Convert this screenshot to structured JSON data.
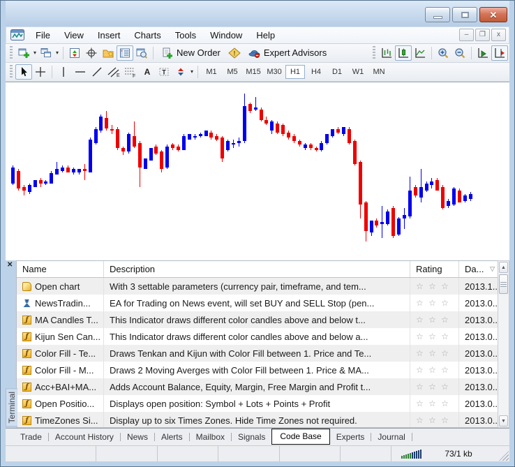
{
  "window": {
    "title": ""
  },
  "icons": {
    "app": "metatrader-logo",
    "window_minimize": "minimize-dash",
    "window_maximize": "maximize-box",
    "window_close": "✕",
    "mdi_minimize": "–",
    "mdi_restore": "❐",
    "mdi_close": "x",
    "dropdown_caret": "▾",
    "sort_desc": "▽",
    "star_empty": "☆",
    "scroll_up": "▲",
    "scroll_down": "▼",
    "panel_close": "✕",
    "channel_letter": "E",
    "fibo_letter": "F",
    "text_tool": "A",
    "text_label_tool": "T",
    "metaeditor_mark": "!"
  },
  "menu": {
    "items": [
      "File",
      "View",
      "Insert",
      "Charts",
      "Tools",
      "Window",
      "Help"
    ]
  },
  "toolbar_standard": {
    "new_order_label": "New Order",
    "expert_advisors_label": "Expert Advisors"
  },
  "toolbar_charts": {
    "timeframes": [
      "M1",
      "M5",
      "M15",
      "M30",
      "H1",
      "H4",
      "D1",
      "W1",
      "MN"
    ],
    "active_timeframe": "H1"
  },
  "codebase_panel": {
    "side_label": "Terminal",
    "columns": [
      "Name",
      "Description",
      "Rating",
      "Da..."
    ],
    "sorted_column": "Da...",
    "sort_direction": "desc",
    "rating_max": 3,
    "rows": [
      {
        "icon": "script-icon",
        "name": "Open chart",
        "description": "With 3 settable parameters (currency pair, timeframe, and tem...",
        "date": "2013.1..."
      },
      {
        "icon": "expert-icon",
        "name": "NewsTradin...",
        "description": "EA for Trading on News event, will set BUY and SELL Stop (pen...",
        "date": "2013.0..."
      },
      {
        "icon": "indicator-icon",
        "name": "MA Candles T...",
        "description": "This Indicator draws different color candles above and below t...",
        "date": "2013.0..."
      },
      {
        "icon": "indicator-icon",
        "name": "Kijun Sen Can...",
        "description": "This Indicator draws different color candles above and below a...",
        "date": "2013.0..."
      },
      {
        "icon": "indicator-icon",
        "name": "Color Fill - Te...",
        "description": "Draws Tenkan and Kijun with Color Fill between 1. Price and Te...",
        "date": "2013.0..."
      },
      {
        "icon": "indicator-icon",
        "name": "Color Fill - M...",
        "description": "Draws 2 Moving Averges with Color Fill between 1. Price & MA...",
        "date": "2013.0..."
      },
      {
        "icon": "indicator-icon",
        "name": "Acc+BAI+MA...",
        "description": "Adds Account Balance, Equity, Margin, Free Margin and Profit t...",
        "date": "2013.0..."
      },
      {
        "icon": "indicator-icon",
        "name": "Open Positio...",
        "description": "Displays open position: Symbol + Lots + Points + Profit",
        "date": "2013.0..."
      },
      {
        "icon": "indicator-icon",
        "name": "TimeZones Si...",
        "description": "Display up to six Times Zones. Hide Time Zones not required.",
        "date": "2013.0..."
      }
    ]
  },
  "tabs": {
    "items": [
      "Trade",
      "Account History",
      "News",
      "Alerts",
      "Mailbox",
      "Signals",
      "Code Base",
      "Experts",
      "Journal"
    ],
    "active": "Code Base"
  },
  "status_bar": {
    "traffic": "73/1 kb"
  },
  "colors": {
    "bull": "#0000ee",
    "bear": "#ee0000",
    "chart_background": "#ffffff",
    "window_frame": "#bcd2e8",
    "close_button": "#c05a38"
  },
  "chart_data": {
    "type": "candlestick",
    "title": "",
    "grid": false,
    "axes_labels_visible": false,
    "units_note": "OHLC in normalized chart units: 0 = bottom of visible chart, 100 = top",
    "up_color": "#0000ee",
    "down_color": "#ee0000",
    "candles": [
      [
        44,
        54,
        43,
        53
      ],
      [
        51,
        52,
        40,
        41
      ],
      [
        42,
        43,
        37,
        40
      ],
      [
        39,
        44,
        38,
        43
      ],
      [
        42,
        46,
        42,
        46
      ],
      [
        46,
        47,
        42,
        44
      ],
      [
        44,
        46,
        43,
        45
      ],
      [
        44,
        51,
        44,
        50
      ],
      [
        49,
        56,
        49,
        52
      ],
      [
        51,
        54,
        50,
        53
      ],
      [
        53,
        54,
        50,
        50
      ],
      [
        50,
        53,
        49,
        52
      ],
      [
        50,
        52,
        49,
        52
      ],
      [
        52,
        55,
        46,
        51
      ],
      [
        50,
        70,
        50,
        69
      ],
      [
        67,
        76,
        66,
        75
      ],
      [
        74,
        83,
        73,
        82
      ],
      [
        81,
        85,
        74,
        75
      ],
      [
        75,
        77,
        72,
        74
      ],
      [
        75,
        76,
        63,
        64
      ],
      [
        64,
        65,
        60,
        62
      ],
      [
        62,
        73,
        61,
        72
      ],
      [
        71,
        79,
        64,
        65
      ],
      [
        67,
        68,
        42,
        53
      ],
      [
        52,
        58,
        52,
        58
      ],
      [
        57,
        64,
        57,
        64
      ],
      [
        65,
        66,
        60,
        61
      ],
      [
        62,
        63,
        50,
        52
      ],
      [
        53,
        66,
        52,
        65
      ],
      [
        66,
        67,
        63,
        64
      ],
      [
        65,
        66,
        62,
        63
      ],
      [
        63,
        72,
        63,
        71
      ],
      [
        69,
        72,
        69,
        72
      ],
      [
        70,
        72,
        69,
        71
      ],
      [
        71,
        73,
        70,
        72
      ],
      [
        71,
        74,
        71,
        74
      ],
      [
        73,
        74,
        69,
        70
      ],
      [
        71,
        72,
        68,
        69
      ],
      [
        70,
        71,
        56,
        58
      ],
      [
        63,
        69,
        62,
        68
      ],
      [
        66,
        69,
        64,
        67
      ],
      [
        67,
        70,
        65,
        68
      ],
      [
        68,
        95,
        67,
        88
      ],
      [
        89,
        90,
        84,
        85
      ],
      [
        86,
        93,
        85,
        87
      ],
      [
        86,
        87,
        79,
        80
      ],
      [
        80,
        82,
        77,
        78
      ],
      [
        74,
        80,
        72,
        79
      ],
      [
        78,
        79,
        72,
        73
      ],
      [
        77,
        78,
        71,
        72
      ],
      [
        73,
        74,
        69,
        70
      ],
      [
        71,
        72,
        67,
        68
      ],
      [
        68,
        69,
        65,
        66
      ],
      [
        64,
        67,
        63,
        66
      ],
      [
        66,
        67,
        63,
        64
      ],
      [
        64,
        65,
        62,
        63
      ],
      [
        63,
        68,
        62,
        67
      ],
      [
        67,
        72,
        66,
        72
      ],
      [
        71,
        75,
        70,
        75
      ],
      [
        75,
        76,
        72,
        73
      ],
      [
        72,
        76,
        71,
        76
      ],
      [
        75,
        76,
        66,
        67
      ],
      [
        68,
        69,
        54,
        55
      ],
      [
        56,
        57,
        24,
        32
      ],
      [
        33,
        34,
        11,
        17
      ],
      [
        16,
        23,
        14,
        23
      ],
      [
        23,
        24,
        19,
        20
      ],
      [
        21,
        31,
        13,
        22
      ],
      [
        21,
        29,
        20,
        28
      ],
      [
        30,
        31,
        13,
        14
      ],
      [
        15,
        25,
        14,
        24
      ],
      [
        24,
        30,
        18,
        26
      ],
      [
        25,
        48,
        24,
        40
      ],
      [
        42,
        43,
        36,
        37
      ],
      [
        36,
        52,
        33,
        42
      ],
      [
        40,
        45,
        39,
        44
      ],
      [
        43,
        47,
        41,
        45
      ],
      [
        46,
        47,
        40,
        40
      ],
      [
        42,
        43,
        29,
        30
      ],
      [
        31,
        35,
        30,
        34
      ],
      [
        32,
        42,
        31,
        41
      ],
      [
        40,
        41,
        33,
        33
      ],
      [
        34,
        38,
        33,
        37
      ],
      [
        35,
        39,
        34,
        38
      ]
    ]
  }
}
